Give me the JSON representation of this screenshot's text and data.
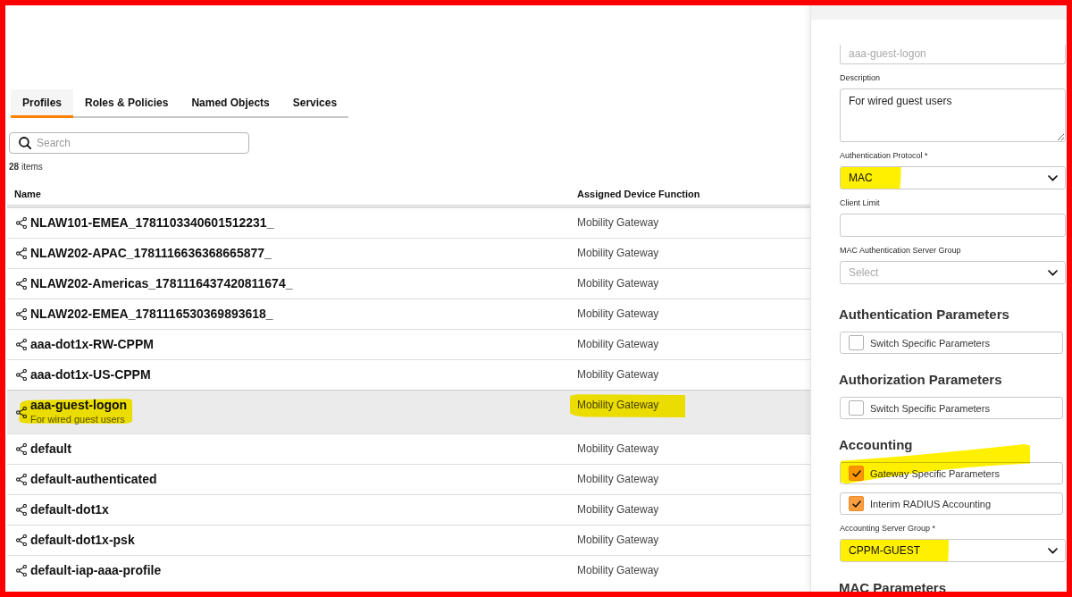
{
  "tabs": [
    {
      "label": "Profiles",
      "selected": true
    },
    {
      "label": "Roles & Policies",
      "selected": false
    },
    {
      "label": "Named Objects",
      "selected": false
    },
    {
      "label": "Services",
      "selected": false
    }
  ],
  "search": {
    "placeholder": "Search"
  },
  "item_count": "**28** items",
  "table": {
    "columns": [
      "Name",
      "Assigned Device Function"
    ],
    "rows": [
      {
        "name": "NLAW101-EMEA_1781103340601512231_",
        "function": "Mobility Gateway",
        "selected": false,
        "highlighted": false
      },
      {
        "name": "NLAW202-APAC_1781116636368665877_",
        "function": "Mobility Gateway",
        "selected": false,
        "highlighted": false
      },
      {
        "name": "NLAW202-Americas_1781116437420811674_",
        "function": "Mobility Gateway",
        "selected": false,
        "highlighted": false
      },
      {
        "name": "NLAW202-EMEA_1781116530369893618_",
        "function": "Mobility Gateway",
        "selected": false,
        "highlighted": false
      },
      {
        "name": "aaa-dot1x-RW-CPPM",
        "function": "Mobility Gateway",
        "selected": false,
        "highlighted": false
      },
      {
        "name": "aaa-dot1x-US-CPPM",
        "function": "Mobility Gateway",
        "selected": false,
        "highlighted": false
      },
      {
        "name": "aaa-guest-logon",
        "description": "For wired guest users",
        "function": "Mobility Gateway",
        "selected": true,
        "highlighted": true
      },
      {
        "name": "default",
        "function": "Mobility Gateway",
        "selected": false,
        "highlighted": false
      },
      {
        "name": "default-authenticated",
        "function": "Mobility Gateway",
        "selected": false,
        "highlighted": false
      },
      {
        "name": "default-dot1x",
        "function": "Mobility Gateway",
        "selected": false,
        "highlighted": false
      },
      {
        "name": "default-dot1x-psk",
        "function": "Mobility Gateway",
        "selected": false,
        "highlighted": false
      },
      {
        "name": "default-iap-aaa-profile",
        "function": "Mobility Gateway",
        "selected": false,
        "highlighted": false
      }
    ]
  },
  "details_panel": {
    "items": [
      {
        "kind": "input",
        "value": "aaa-guest-logon",
        "disabled": true,
        "highlighted": false
      },
      {
        "kind": "textarea",
        "label": "Description",
        "value": "For wired guest users",
        "highlighted": false
      },
      {
        "kind": "select",
        "label": "Authentication Protocol *",
        "value": "MAC",
        "highlighted": true
      },
      {
        "kind": "input",
        "label": "Client Limit",
        "highlighted": false
      },
      {
        "kind": "select",
        "label": "MAC Authentication Server Group",
        "placeholder": "Select",
        "highlighted": false
      },
      {
        "kind": "heading",
        "text": "Authentication Parameters"
      },
      {
        "kind": "checkbox",
        "label": "Switch Specific Parameters",
        "checked": false,
        "highlighted": false
      },
      {
        "kind": "heading",
        "text": "Authorization Parameters"
      },
      {
        "kind": "checkbox",
        "label": "Switch Specific Parameters",
        "checked": false,
        "highlighted": false
      },
      {
        "kind": "heading",
        "text": "Accounting"
      },
      {
        "kind": "checkbox",
        "label": "Gateway Specific Parameters",
        "checked": true,
        "highlighted": true
      },
      {
        "kind": "checkbox",
        "label": "Interim RADIUS Accounting",
        "checked": true,
        "highlighted": false
      },
      {
        "kind": "select",
        "label": "Accounting Server Group *",
        "value": "CPPM-GUEST",
        "highlighted": true
      },
      {
        "kind": "heading",
        "text": "MAC Parameters"
      }
    ]
  }
}
